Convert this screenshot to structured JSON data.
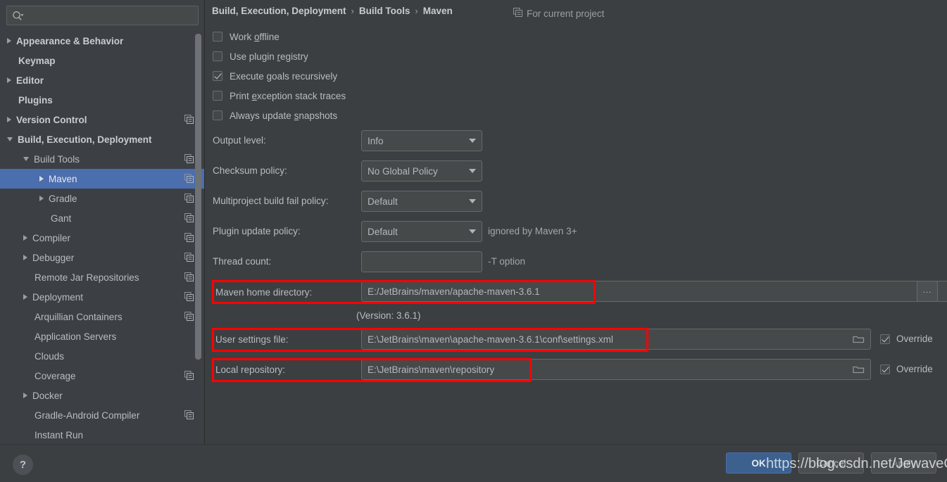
{
  "search": {
    "placeholder": "",
    "value": "",
    "icon": "search-icon"
  },
  "sidebar": {
    "items": [
      {
        "label": "Appearance & Behavior",
        "indent": 0,
        "arrow": "right",
        "bold": true,
        "scope": false,
        "selected": false
      },
      {
        "label": "Keymap",
        "indent": 0,
        "arrow": "none",
        "bold": true,
        "scope": false,
        "selected": false
      },
      {
        "label": "Editor",
        "indent": 0,
        "arrow": "right",
        "bold": true,
        "scope": false,
        "selected": false
      },
      {
        "label": "Plugins",
        "indent": 0,
        "arrow": "none",
        "bold": true,
        "scope": false,
        "selected": false
      },
      {
        "label": "Version Control",
        "indent": 0,
        "arrow": "right",
        "bold": true,
        "scope": true,
        "selected": false
      },
      {
        "label": "Build, Execution, Deployment",
        "indent": 0,
        "arrow": "down",
        "bold": true,
        "scope": false,
        "selected": false
      },
      {
        "label": "Build Tools",
        "indent": 1,
        "arrow": "down",
        "bold": false,
        "scope": true,
        "selected": false
      },
      {
        "label": "Maven",
        "indent": 2,
        "arrow": "right",
        "bold": false,
        "scope": true,
        "selected": true
      },
      {
        "label": "Gradle",
        "indent": 2,
        "arrow": "right",
        "bold": false,
        "scope": true,
        "selected": false
      },
      {
        "label": "Gant",
        "indent": 2,
        "arrow": "none",
        "bold": false,
        "scope": true,
        "selected": false
      },
      {
        "label": "Compiler",
        "indent": 1,
        "arrow": "right",
        "bold": false,
        "scope": true,
        "selected": false
      },
      {
        "label": "Debugger",
        "indent": 1,
        "arrow": "right",
        "bold": false,
        "scope": true,
        "selected": false
      },
      {
        "label": "Remote Jar Repositories",
        "indent": 1,
        "arrow": "none",
        "bold": false,
        "scope": true,
        "selected": false
      },
      {
        "label": "Deployment",
        "indent": 1,
        "arrow": "right",
        "bold": false,
        "scope": true,
        "selected": false
      },
      {
        "label": "Arquillian Containers",
        "indent": 1,
        "arrow": "none",
        "bold": false,
        "scope": true,
        "selected": false
      },
      {
        "label": "Application Servers",
        "indent": 1,
        "arrow": "none",
        "bold": false,
        "scope": false,
        "selected": false
      },
      {
        "label": "Clouds",
        "indent": 1,
        "arrow": "none",
        "bold": false,
        "scope": false,
        "selected": false
      },
      {
        "label": "Coverage",
        "indent": 1,
        "arrow": "none",
        "bold": false,
        "scope": true,
        "selected": false
      },
      {
        "label": "Docker",
        "indent": 1,
        "arrow": "right",
        "bold": false,
        "scope": false,
        "selected": false
      },
      {
        "label": "Gradle-Android Compiler",
        "indent": 1,
        "arrow": "none",
        "bold": false,
        "scope": true,
        "selected": false
      },
      {
        "label": "Instant Run",
        "indent": 1,
        "arrow": "none",
        "bold": false,
        "scope": false,
        "selected": false
      }
    ]
  },
  "breadcrumb": {
    "parts": [
      "Build, Execution, Deployment",
      "Build Tools",
      "Maven"
    ],
    "separator": "›"
  },
  "scope_note": {
    "icon": "project-scope-icon",
    "label": "For current project"
  },
  "checkboxes": [
    {
      "label_pre": "Work ",
      "mnemonic": "o",
      "label_post": "ffline",
      "checked": false
    },
    {
      "label_pre": "Use plugin ",
      "mnemonic": "r",
      "label_post": "egistry",
      "checked": false
    },
    {
      "label_pre": "Execute ",
      "mnemonic": "g",
      "label_post": "oals recursively",
      "checked": true
    },
    {
      "label_pre": "Print ",
      "mnemonic": "e",
      "label_post": "xception stack traces",
      "checked": false
    },
    {
      "label_pre": "Always update ",
      "mnemonic": "s",
      "label_post": "napshots",
      "checked": false
    }
  ],
  "fields": {
    "output_level": {
      "label": "Output level:",
      "value": "Info"
    },
    "checksum_policy": {
      "label": "Checksum policy:",
      "value": "No Global Policy"
    },
    "multiproject": {
      "label": "Multiproject build fail policy:",
      "value": "Default"
    },
    "plugin_update": {
      "label": "Plugin update policy:",
      "value": "Default",
      "note": "ignored by Maven 3+"
    },
    "thread_count": {
      "label": "Thread count:",
      "value": "",
      "note": "-T option"
    },
    "maven_home": {
      "label": "Maven home directory:",
      "value": "E:/JetBrains/maven/apache-maven-3.6.1",
      "browse": "...",
      "version_note": "(Version: 3.6.1)"
    },
    "user_settings": {
      "label": "User settings file:",
      "value": "E:\\JetBrains\\maven\\apache-maven-3.6.1\\conf\\settings.xml",
      "override_label": "Override",
      "override_checked": true
    },
    "local_repo": {
      "label": "Local repository:",
      "value": "E:\\JetBrains\\maven\\repository",
      "override_label": "Override",
      "override_checked": true
    }
  },
  "buttons": {
    "help": "?",
    "ok": "OK",
    "cancel": "Cancel",
    "apply": "Apply"
  },
  "watermark": "https://blog.csdn.net/JewaveOxford",
  "colors": {
    "selection": "#4b6eaf",
    "panel_bg": "#3c3f41",
    "sidebar_bg": "#3c4044",
    "field_bg": "#45494a",
    "annotation_red": "#ff0000",
    "ok_button": "#3c618f"
  }
}
